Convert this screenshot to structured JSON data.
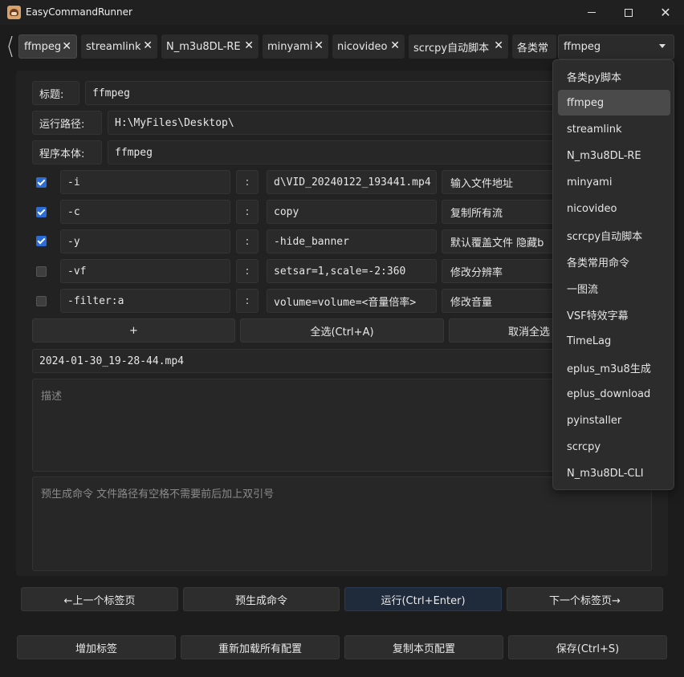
{
  "window": {
    "title": "EasyCommandRunner",
    "minimize_icon": "minimize-icon",
    "maximize_icon": "maximize-icon",
    "close_glyph": "✕"
  },
  "tabs": [
    {
      "label": "ffmpeg",
      "active": true
    },
    {
      "label": "streamlink",
      "active": false
    },
    {
      "label": "N_m3u8DL-RE",
      "active": false
    },
    {
      "label": "minyami",
      "active": false
    },
    {
      "label": "nicovideo",
      "active": false
    },
    {
      "label": "scrcpy自动脚本",
      "active": false
    },
    {
      "label": "各类常",
      "active": false
    }
  ],
  "tab_close_glyph": "✕",
  "tab_select": {
    "value": "ffmpeg"
  },
  "form": {
    "title_label": "标题:",
    "title_value": "ffmpeg",
    "path_label": "运行路径:",
    "path_value": "H:\\MyFiles\\Desktop\\",
    "program_label": "程序本体:",
    "program_value": "ffmpeg"
  },
  "params": [
    {
      "checked": true,
      "flag": "-i",
      "colon": ":",
      "value": "d\\VID_20240122_193441.mp4",
      "desc": "输入文件地址"
    },
    {
      "checked": true,
      "flag": "-c",
      "colon": ":",
      "value": "copy",
      "desc": "复制所有流"
    },
    {
      "checked": true,
      "flag": "-y",
      "colon": ":",
      "value": "-hide_banner",
      "desc": "默认覆盖文件 隐藏b"
    },
    {
      "checked": false,
      "flag": "-vf",
      "colon": ":",
      "value": "setsar=1,scale=-2:360",
      "desc": "修改分辨率"
    },
    {
      "checked": false,
      "flag": "-filter:a",
      "colon": ":",
      "value": "volume=volume=<音量倍率>",
      "desc": "修改音量"
    }
  ],
  "param_buttons": {
    "add": "+",
    "select_all": "全选(Ctrl+A)",
    "deselect_all": "取消全选"
  },
  "output_file": "2024-01-30_19-28-44.mp4",
  "description_placeholder": "描述",
  "command_placeholder": "预生成命令  文件路径有空格不需要前后加上双引号",
  "nav_buttons": {
    "prev": "←上一个标签页",
    "pregen": "预生成命令",
    "run": "运行(Ctrl+Enter)",
    "next": "下一个标签页→"
  },
  "bottom_buttons": {
    "add_tag": "增加标签",
    "reload": "重新加载所有配置",
    "copy": "复制本页配置",
    "save": "保存(Ctrl+S)"
  },
  "dropdown": {
    "items": [
      "各类py脚本",
      "ffmpeg",
      "streamlink",
      "N_m3u8DL-RE",
      "minyami",
      "nicovideo",
      "scrcpy自动脚本",
      "各类常用命令",
      "一图流",
      "VSF特效字幕",
      "TimeLag",
      "eplus_m3u8生成",
      "eplus_download",
      "pyinstaller",
      "scrcpy",
      "N_m3u8DL-CLI"
    ],
    "selected": "ffmpeg"
  },
  "colors": {
    "background": "#1c1c1c",
    "panel": "#222222",
    "accent": "#2c6cd6",
    "run_button": "#1f2a3a"
  }
}
